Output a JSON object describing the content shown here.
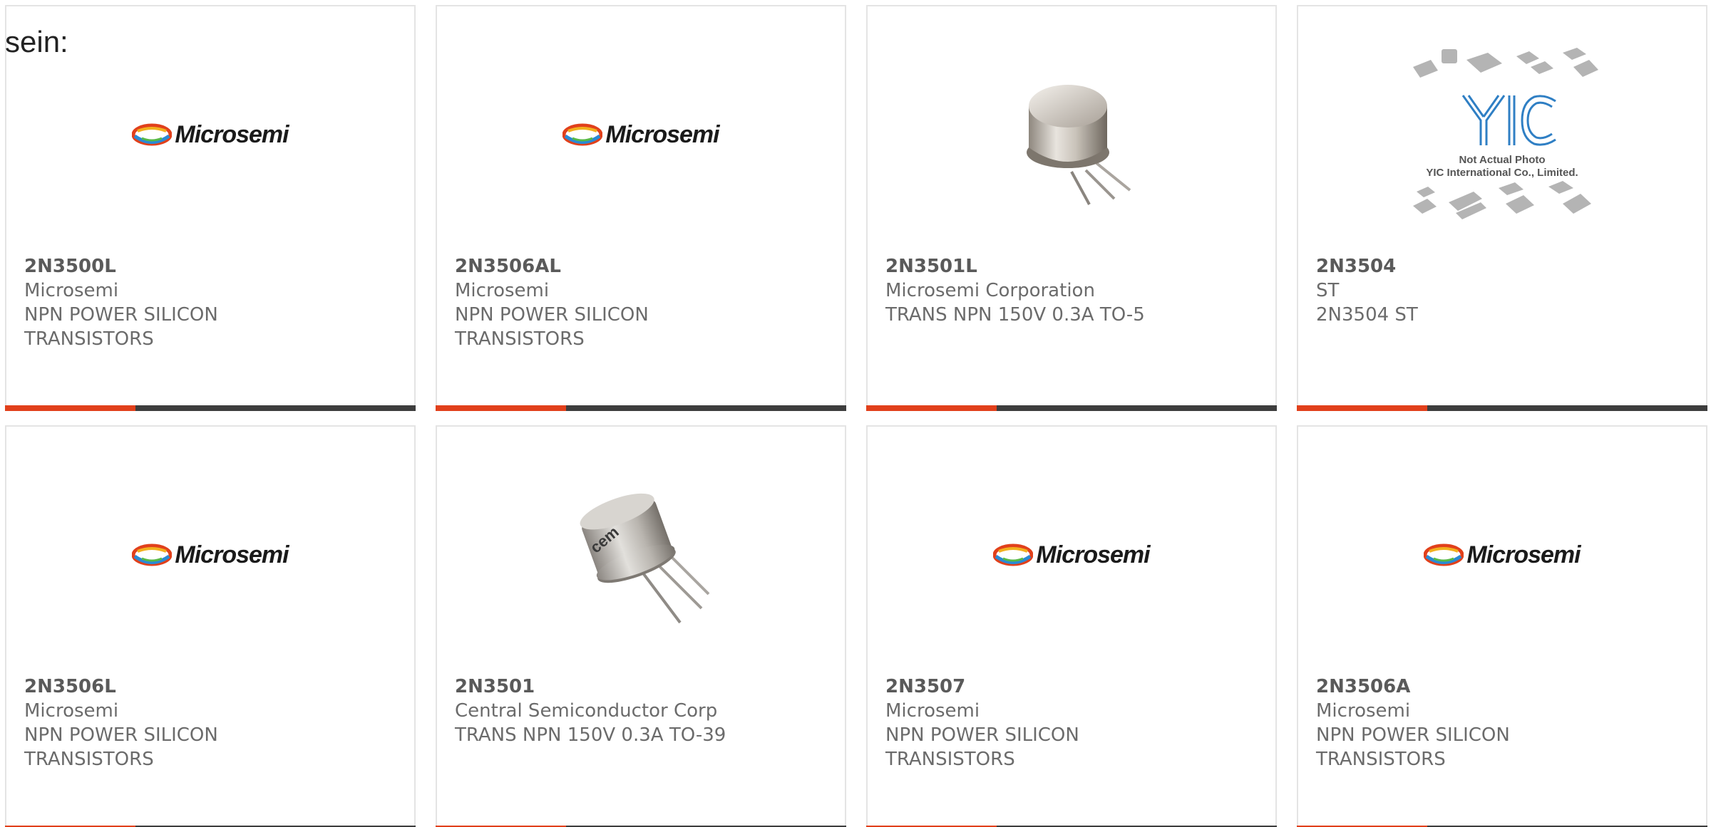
{
  "intro_text": "sein:",
  "colors": {
    "accent": "#e1401b",
    "bar_dark": "#3d3d3d",
    "card_border": "#e4e4e4",
    "text": "#6b6b6b"
  },
  "products": [
    {
      "part": "2N3500L",
      "manufacturer": "Microsemi",
      "description": "NPN POWER SILICON TRANSISTORS",
      "image": "microsemi-logo"
    },
    {
      "part": "2N3506AL",
      "manufacturer": "Microsemi",
      "description": "NPN POWER SILICON TRANSISTORS",
      "image": "microsemi-logo"
    },
    {
      "part": "2N3501L",
      "manufacturer": "Microsemi Corporation",
      "description": "TRANS NPN 150V 0.3A TO-5",
      "image": "to5-transistor-photo"
    },
    {
      "part": "2N3504",
      "manufacturer": "ST",
      "description": "2N3504 ST",
      "image": "yic-placeholder",
      "image_caption_1": "Not Actual Photo",
      "image_caption_2": "YIC International Co., Limited.",
      "image_logo_text": "YIC"
    },
    {
      "part": "2N3506L",
      "manufacturer": "Microsemi",
      "description": "NPN POWER SILICON TRANSISTORS",
      "image": "microsemi-logo"
    },
    {
      "part": "2N3501",
      "manufacturer": "Central Semiconductor Corp",
      "description": "TRANS NPN 150V 0.3A TO-39",
      "image": "to39-transistor-photo"
    },
    {
      "part": "2N3507",
      "manufacturer": "Microsemi",
      "description": "NPN POWER SILICON TRANSISTORS",
      "image": "microsemi-logo"
    },
    {
      "part": "2N3506A",
      "manufacturer": "Microsemi",
      "description": "NPN POWER SILICON TRANSISTORS",
      "image": "microsemi-logo"
    }
  ],
  "microsemi_logo_text": "Microsemi"
}
